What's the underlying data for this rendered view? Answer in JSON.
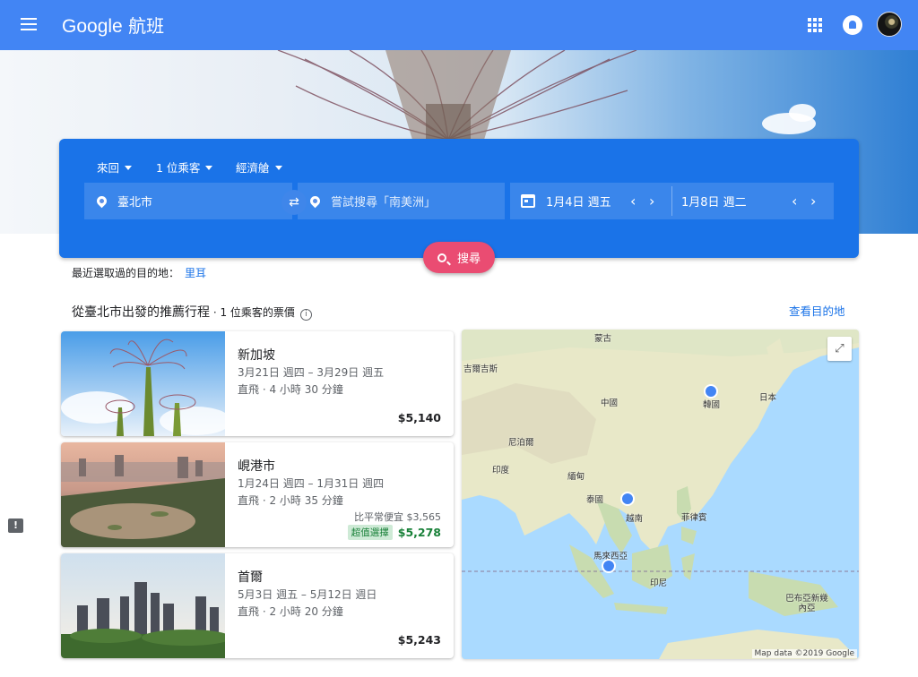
{
  "app": {
    "brand_google": "Google",
    "brand_product": "航班"
  },
  "search": {
    "trip_type": "來回",
    "passengers": "1 位乘客",
    "cabin": "經濟艙",
    "origin": "臺北市",
    "destination_placeholder": "嘗試搜尋「南美洲」",
    "depart_date": "1月4日 週五",
    "return_date": "1月8日 週二",
    "search_label": "搜尋"
  },
  "recent": {
    "label": "最近選取過的目的地：",
    "link": "里耳"
  },
  "section": {
    "title": "從臺北市出發的推薦行程",
    "subtitle": " · 1 位乘客的票價",
    "see_destinations": "查看目的地"
  },
  "cards": [
    {
      "city": "新加坡",
      "dates": "3月21日 週四 – 3月29日 週五",
      "flight": "直飛 · 4 小時 30 分鐘",
      "price": "$5,140"
    },
    {
      "city": "峴港市",
      "dates": "1月24日 週四 – 1月31日 週四",
      "flight": "直飛 · 2 小時 35 分鐘",
      "cheaper": "比平常便宜 $3,565",
      "badge": "超值選擇",
      "price": "$5,278"
    },
    {
      "city": "首爾",
      "dates": "5月3日 週五 – 5月12日 週日",
      "flight": "直飛 · 2 小時 20 分鐘",
      "price": "$5,243"
    }
  ],
  "map": {
    "labels": [
      "蒙古",
      "中國",
      "日本",
      "韓國",
      "尼泊爾",
      "印度",
      "緬甸",
      "泰國",
      "越南",
      "菲律賓",
      "馬來西亞",
      "印尼",
      "巴布亞新幾內亞",
      "吉爾吉斯"
    ],
    "attribution": "Map data ©2019 Google"
  },
  "colors": {
    "app_bar": "#4285f4",
    "search_panel": "#1a73e8",
    "search_button": "#ea4c72",
    "deal_green": "#188038"
  }
}
